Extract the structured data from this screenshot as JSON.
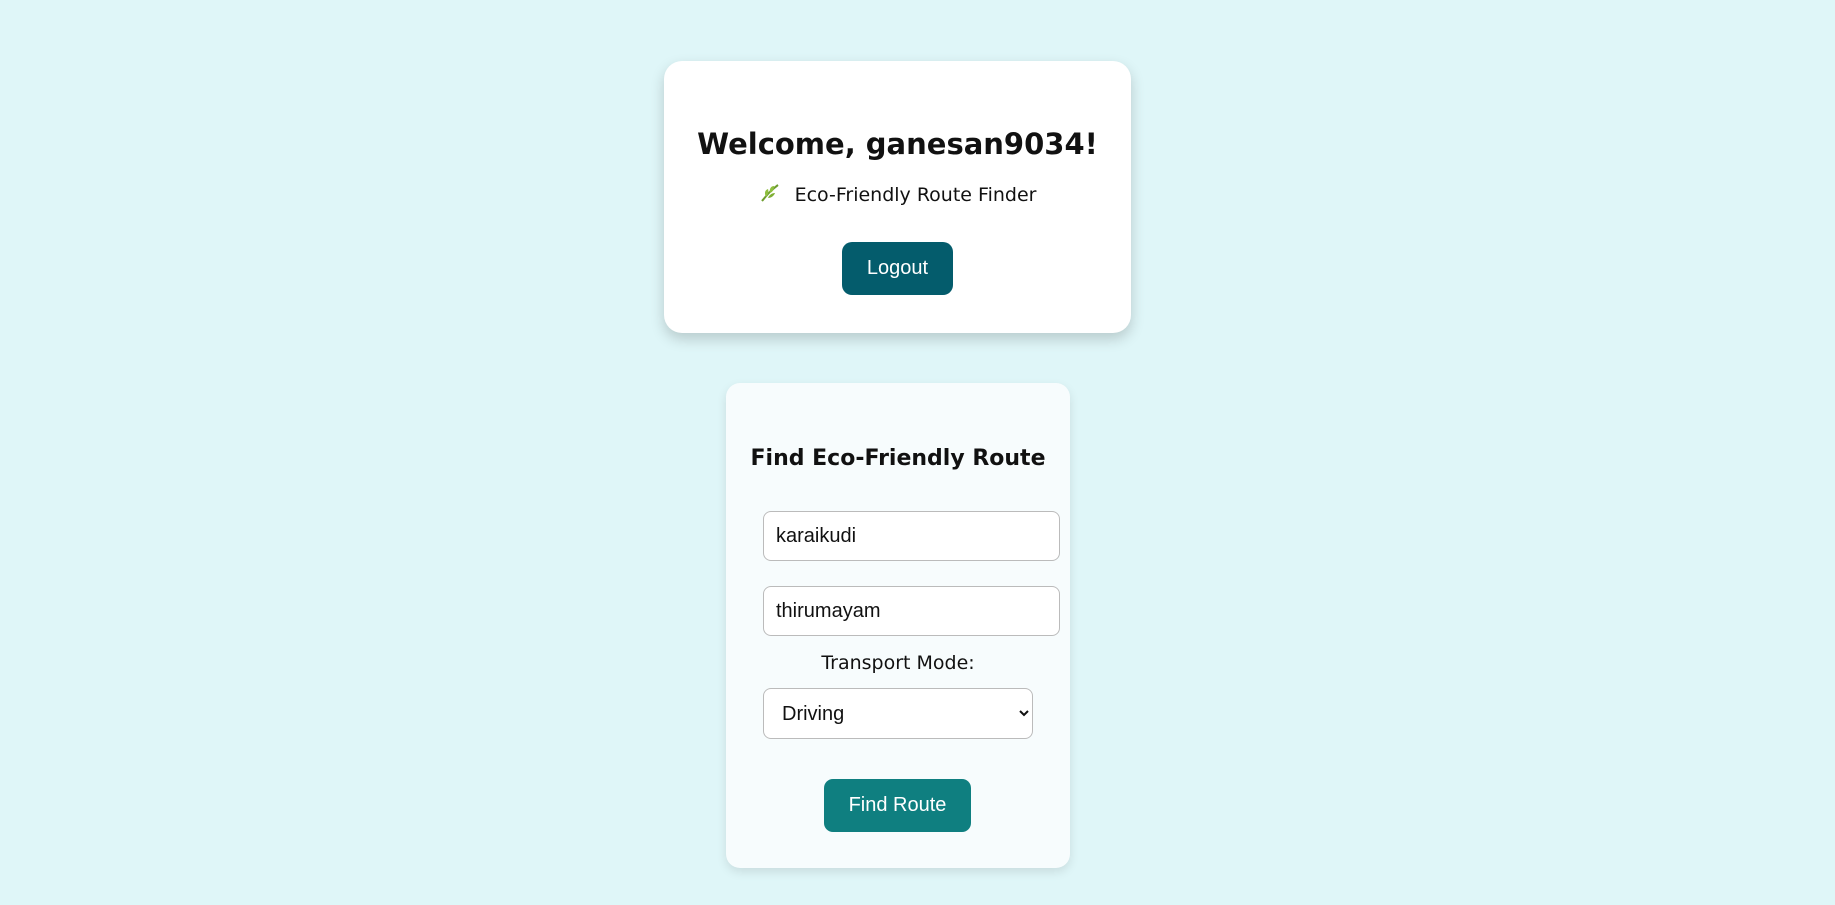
{
  "welcome": {
    "title": "Welcome, ganesan9034!",
    "subtitle": "Eco-Friendly Route Finder",
    "leaf_icon": "leaf-icon",
    "logout_label": "Logout"
  },
  "route_form": {
    "title": "Find Eco-Friendly Route",
    "from_value": "karaikudi",
    "to_value": "thirumayam",
    "mode_label": "Transport Mode:",
    "mode_selected": "Driving",
    "find_label": "Find Route"
  },
  "colors": {
    "background": "#dff6f8",
    "logout_button": "#045c6c",
    "find_button": "#0f7f80"
  }
}
